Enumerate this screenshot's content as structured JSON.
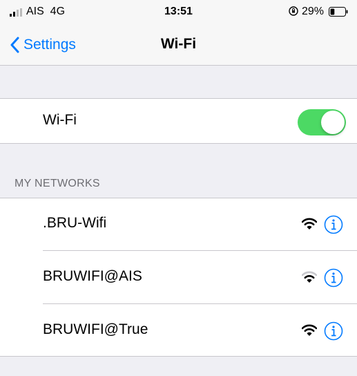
{
  "status_bar": {
    "carrier": "AIS  4G",
    "time": "13:51",
    "battery_percent": "29%",
    "battery_level": 0.29
  },
  "nav": {
    "back_label": "Settings",
    "title": "Wi-Fi"
  },
  "wifi_toggle": {
    "label": "Wi-Fi",
    "on": true,
    "color": "#4cd964"
  },
  "my_networks": {
    "header": "MY NETWORKS",
    "items": [
      {
        "name": ".BRU-Wifi",
        "signal_icon": "wifi-full-icon"
      },
      {
        "name": "BRUWIFI@AIS",
        "signal_icon": "wifi-medium-icon"
      },
      {
        "name": "BRUWIFI@True",
        "signal_icon": "wifi-full-icon"
      }
    ]
  },
  "colors": {
    "accent": "#007aff",
    "background": "#efeff4"
  }
}
